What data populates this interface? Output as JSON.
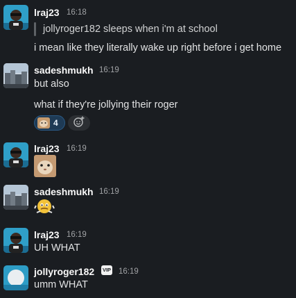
{
  "messages": [
    {
      "user": "lraj23",
      "time": "16:18",
      "quote": "jollyroger182 sleeps when i'm at school",
      "text": "i mean like they literally wake up right before i get home"
    },
    {
      "user": "sadeshmukh",
      "time": "16:19",
      "line1": "but also",
      "line2": "what if they're jollying their roger",
      "reaction_count": "4"
    },
    {
      "user": "lraj23",
      "time": "16:19"
    },
    {
      "user": "sadeshmukh",
      "time": "16:19"
    },
    {
      "user": "lraj23",
      "time": "16:19",
      "text": "UH WHAT"
    },
    {
      "user": "jollyroger182",
      "time": "16:19",
      "badge": "VIP",
      "text": "umm WHAT"
    }
  ],
  "icons": {
    "reaction_emoji": "cat-face-image",
    "add_reaction": "add-emoji-icon",
    "sticker_3": "cat-face-image",
    "sticker_4": "sweating-emoji"
  },
  "colors": {
    "background": "#1a1d21",
    "reaction_bg": "#1e3a55",
    "reaction_border": "#2a5a86"
  }
}
